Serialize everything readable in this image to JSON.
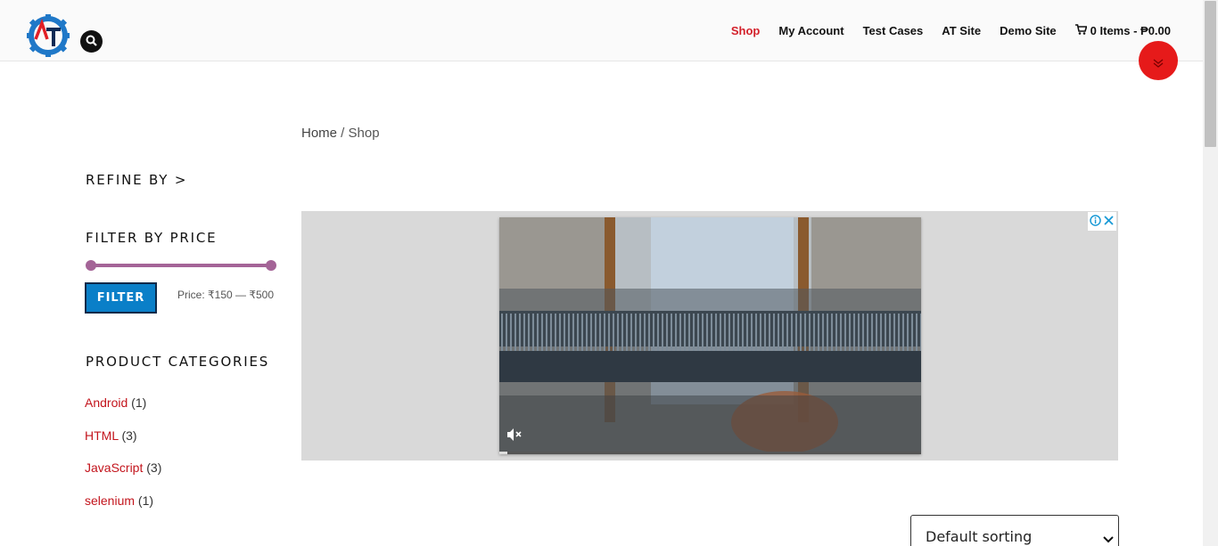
{
  "header": {
    "logo_icon": "gear-logo-icon",
    "search_icon": "search-icon",
    "nav": [
      {
        "label": "Shop",
        "active": true
      },
      {
        "label": "My Account",
        "active": false
      },
      {
        "label": "Test Cases",
        "active": false
      },
      {
        "label": "AT Site",
        "active": false
      },
      {
        "label": "Demo Site",
        "active": false
      }
    ],
    "cart": {
      "icon": "cart-icon",
      "label": "0 Items - ₱0.00"
    }
  },
  "float_button": {
    "icon": "chevron-down-icon",
    "color": "#e61a1a"
  },
  "breadcrumb": {
    "home": "Home",
    "separator": " / ",
    "current": "Shop"
  },
  "sidebar": {
    "refine_heading": "REFINE BY >",
    "price_heading": "FILTER BY PRICE",
    "filter_button": "FILTER",
    "price_range_text": "Price: ₹150 — ₹500",
    "price_min_fraction": 0,
    "price_max_fraction": 1,
    "categories_heading": "PRODUCT CATEGORIES",
    "categories": [
      {
        "name": "Android",
        "count": "(1)"
      },
      {
        "name": "HTML",
        "count": "(3)"
      },
      {
        "name": "JavaScript",
        "count": "(3)"
      },
      {
        "name": "selenium",
        "count": "(1)"
      }
    ]
  },
  "ad": {
    "info_icon": "info-icon",
    "close_icon": "close-icon",
    "mute_icon": "muted-speaker-icon",
    "progress_fraction": 0.02
  },
  "sort": {
    "selected": "Default sorting"
  },
  "colors": {
    "accent_red": "#d3202a",
    "filter_blue": "#0a7fc8",
    "slider_purple": "#a46497"
  }
}
